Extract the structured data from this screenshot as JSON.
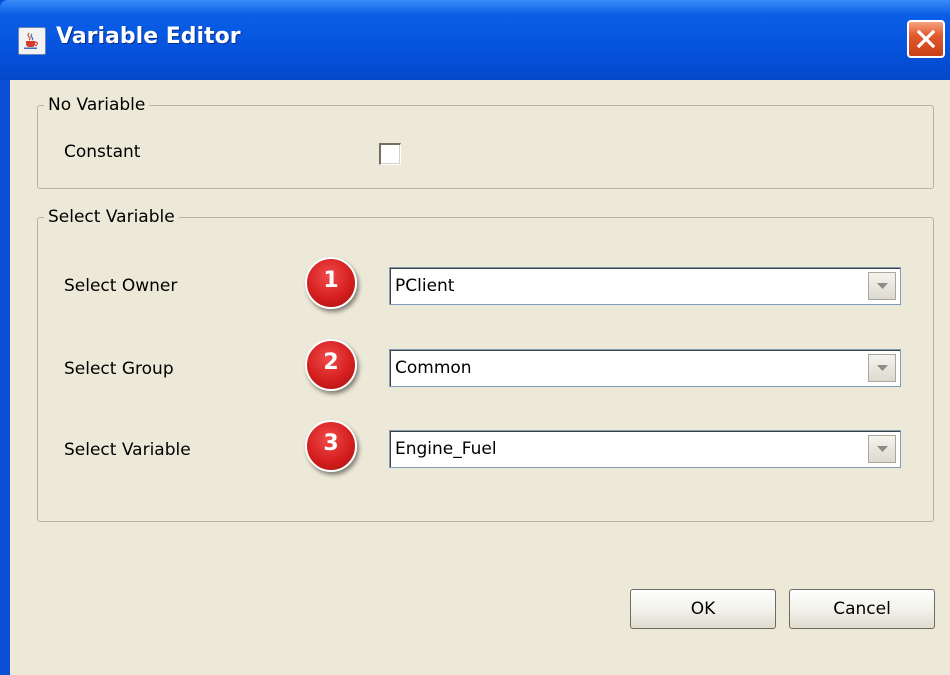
{
  "window": {
    "title": "Variable Editor",
    "icon": "java-cup-icon",
    "close_icon": "close-icon"
  },
  "no_variable_group": {
    "legend": "No Variable",
    "constant_label": "Constant",
    "constant_checked": false
  },
  "select_variable_group": {
    "legend": "Select Variable",
    "rows": [
      {
        "label": "Select Owner",
        "badge": "1",
        "value": "PClient"
      },
      {
        "label": "Select Group",
        "badge": "2",
        "value": "Common"
      },
      {
        "label": "Select Variable",
        "badge": "3",
        "value": "Engine_Fuel"
      }
    ]
  },
  "buttons": {
    "ok": "OK",
    "cancel": "Cancel"
  },
  "colors": {
    "title_bar": "#0654e0",
    "client_bg": "#ece9d8",
    "badge": "#d61f1f",
    "close_button": "#e2592e"
  }
}
